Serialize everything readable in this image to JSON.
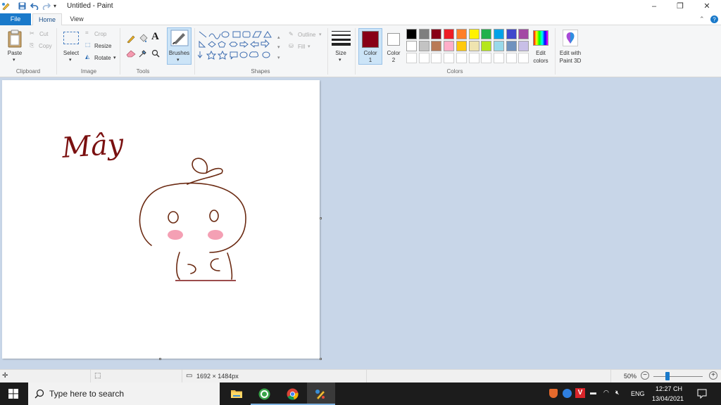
{
  "window": {
    "title": "Untitled - Paint",
    "minimize": "–",
    "maximize": "❐",
    "close": "✕"
  },
  "menu": {
    "tabs": [
      "File",
      "Home",
      "View"
    ]
  },
  "ribbon": {
    "clipboard": {
      "paste": "Paste",
      "cut": "Cut",
      "copy": "Copy",
      "label": "Clipboard"
    },
    "image": {
      "select": "Select",
      "crop": "Crop",
      "resize": "Resize",
      "rotate": "Rotate",
      "label": "Image"
    },
    "tools": {
      "label": "Tools",
      "text_tool": "A"
    },
    "brushes": {
      "label": "Brushes"
    },
    "shapes": {
      "outline": "Outline",
      "fill": "Fill",
      "label": "Shapes"
    },
    "size": {
      "label": "Size"
    },
    "colors": {
      "color1": "Color\n1",
      "color1_line1": "Color",
      "color1_line2": "1",
      "color2_line1": "Color",
      "color2_line2": "2",
      "color1_value": "#880015",
      "color2_value": "#ffffff",
      "palette_row1": [
        "#000000",
        "#7f7f7f",
        "#880015",
        "#ed1c24",
        "#ff7f27",
        "#fff200",
        "#22b14c",
        "#00a2e8",
        "#3f48cc",
        "#a349a4"
      ],
      "palette_row2": [
        "#ffffff",
        "#c3c3c3",
        "#b97a57",
        "#ffaec9",
        "#ffc90e",
        "#efe4b0",
        "#b5e61d",
        "#99d9ea",
        "#7092be",
        "#c8bfe7"
      ],
      "edit_colors_line1": "Edit",
      "edit_colors_line2": "colors",
      "edit3d_line1": "Edit with",
      "edit3d_line2": "Paint 3D",
      "label": "Colors"
    }
  },
  "canvas": {
    "handwriting": "Mây",
    "stroke_color": "#6b2a12",
    "blush_color": "#f4a0b4"
  },
  "status": {
    "dimensions": "1692 × 1484px",
    "zoom": "50%",
    "zoom_fraction": 0.5
  },
  "taskbar": {
    "search_placeholder": "Type here to search",
    "language": "ENG",
    "time": "12:27 CH",
    "date": "13/04/2021"
  }
}
